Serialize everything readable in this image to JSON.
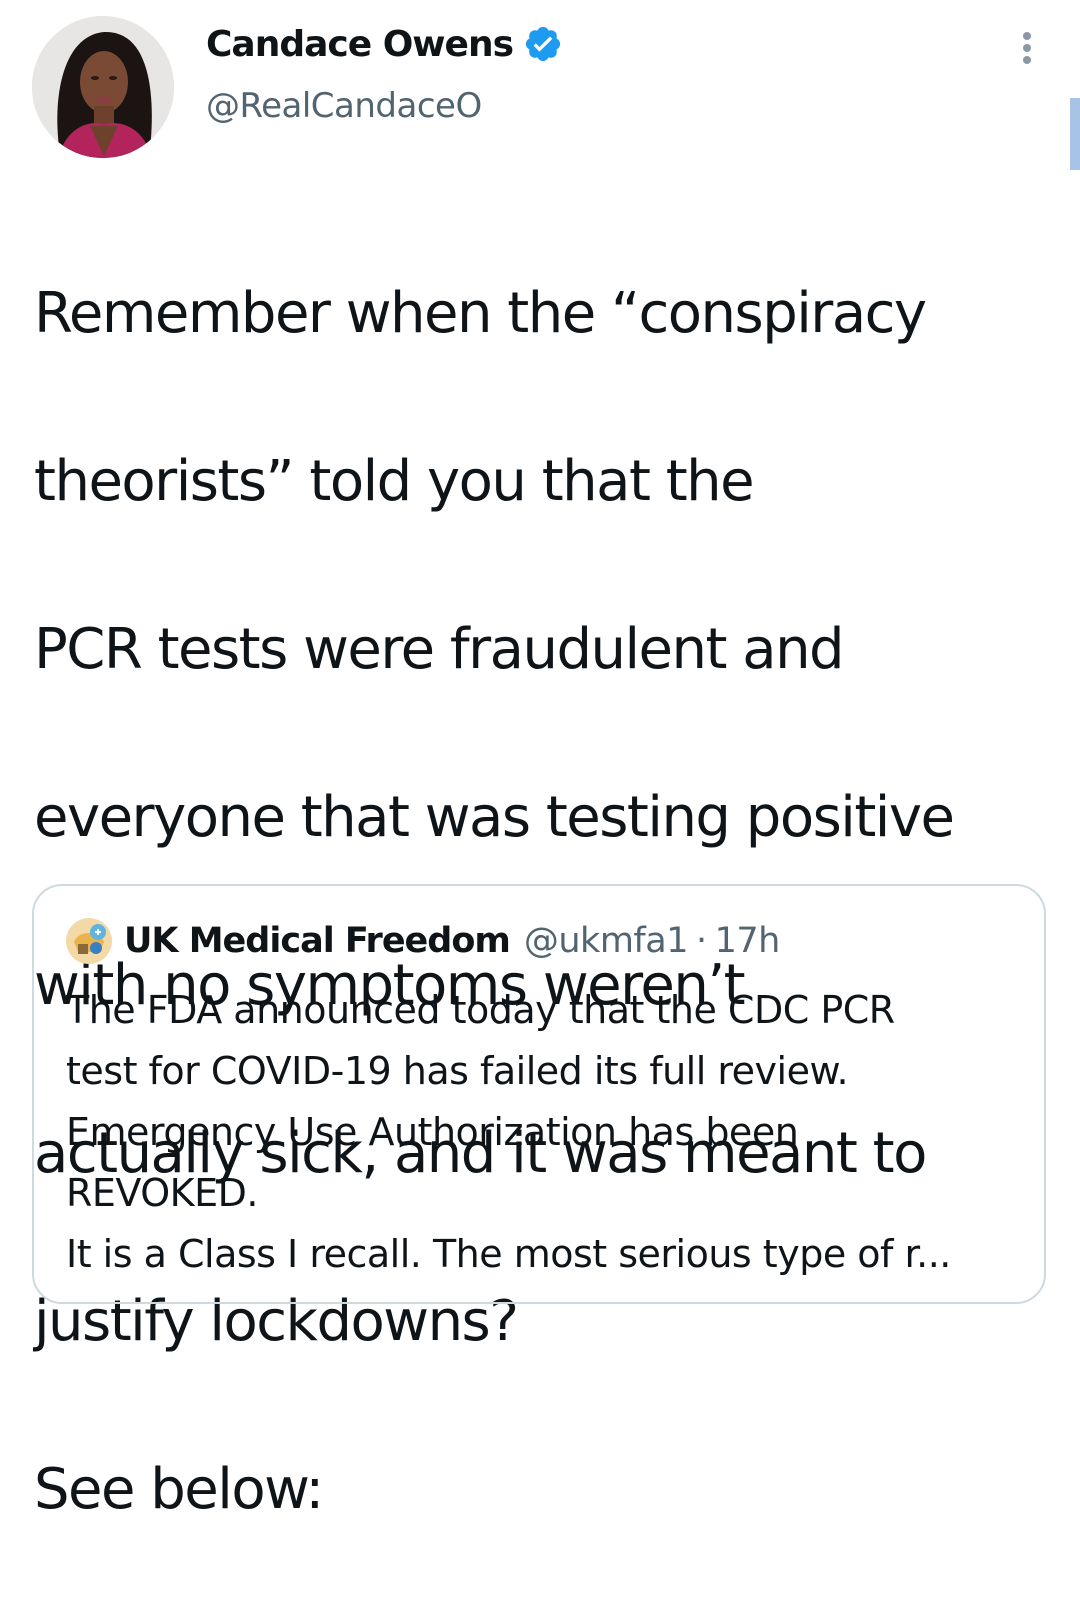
{
  "author": {
    "display_name": "Candace Owens",
    "handle": "@RealCandaceO",
    "verified": true,
    "avatar_icon": "profile-photo"
  },
  "tweet": {
    "text_lines": [
      "Remember when the “conspiracy",
      "theorists” told you that the",
      "PCR tests were fraudulent and",
      "everyone that was testing positive",
      "with no symptoms weren’t",
      "actually sick, and it was meant to",
      "justify lockdowns?",
      "See below:"
    ]
  },
  "quoted_tweet": {
    "display_name": "UK Medical Freedom",
    "handle": "@ukmfa1",
    "separator": "·",
    "time": "17h",
    "text_lines": [
      "The FDA announced today that the CDC PCR",
      "test for COVID-19 has failed its full review.",
      "Emergency Use Authorization has been",
      "REVOKED.",
      "It is a Class I recall. The most serious type of r..."
    ]
  },
  "colors": {
    "primary_text": "#0f1419",
    "secondary_text": "#536471",
    "verified_blue": "#1d9bf0",
    "border": "#cfd9de"
  }
}
